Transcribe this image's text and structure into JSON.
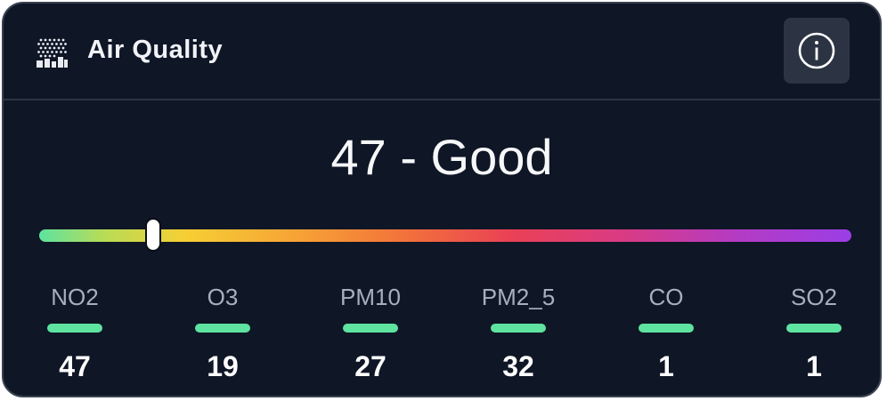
{
  "widget": {
    "title": "Air Quality",
    "app_icon": "air-quality-icon",
    "info_icon": "info-icon"
  },
  "aqi": {
    "value": 47,
    "label": "47 - Good",
    "scale_position": 0.14
  },
  "pollutants": [
    {
      "name": "NO2",
      "value": "47",
      "color": "#5ee3a0"
    },
    {
      "name": "O3",
      "value": "19",
      "color": "#5ee3a0"
    },
    {
      "name": "PM10",
      "value": "27",
      "color": "#5ee3a0"
    },
    {
      "name": "PM2_5",
      "value": "32",
      "color": "#5ee3a0"
    },
    {
      "name": "CO",
      "value": "1",
      "color": "#5ee3a0"
    },
    {
      "name": "SO2",
      "value": "1",
      "color": "#5ee3a0"
    }
  ],
  "colors": {
    "background": "#0f1626",
    "good": "#5ee3a0",
    "scale_start": "#5ee3a0",
    "scale_end": "#9b3ee6"
  }
}
